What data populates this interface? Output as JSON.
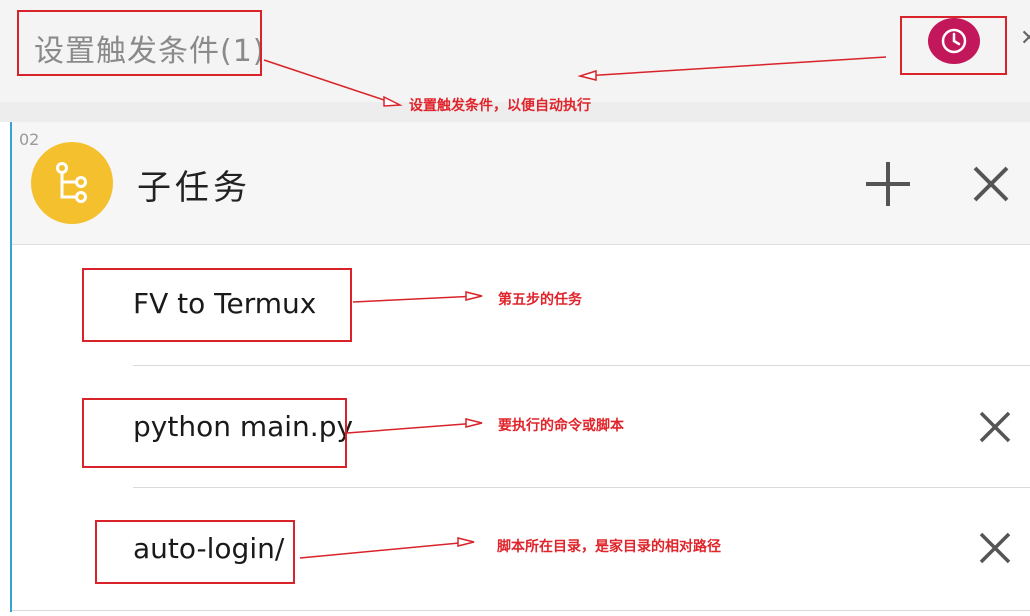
{
  "header": {
    "title": "设置触发条件(1)",
    "clock_icon": "clock-icon"
  },
  "card": {
    "step_number": "02",
    "title": "子任务",
    "icon": "subtask-tree-icon",
    "rows": [
      {
        "text": "FV to Termux",
        "removable": false
      },
      {
        "text": "python main.py",
        "removable": true
      },
      {
        "text": "auto-login/",
        "removable": true
      }
    ]
  },
  "annotations": {
    "trigger_note": "设置触发条件，以便自动执行",
    "task_note": "第五步的任务",
    "command_note": "要执行的命令或脚本",
    "dir_note": "脚本所在目录，是家目录的相对路径"
  },
  "colors": {
    "accent_magenta": "#c2185b",
    "icon_yellow": "#f4c02e",
    "annotation_red": "#e0242b",
    "card_border_blue": "#3aa3d6"
  }
}
